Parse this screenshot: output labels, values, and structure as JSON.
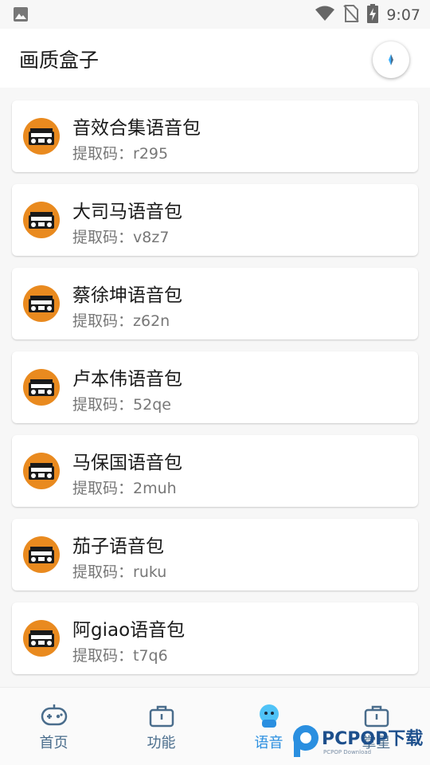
{
  "status_bar": {
    "time": "9:07",
    "icons": [
      "image-icon",
      "wifi-icon",
      "no-sim-icon",
      "battery-charging-icon"
    ]
  },
  "app_bar": {
    "title": "画质盒子",
    "action_icon": "compass-icon"
  },
  "voice_packs": [
    {
      "title": "音效合集语音包",
      "code_label": "提取码：",
      "code": "r295"
    },
    {
      "title": "大司马语音包",
      "code_label": "提取码：",
      "code": "v8z7"
    },
    {
      "title": "蔡徐坤语音包",
      "code_label": "提取码：",
      "code": "z62n"
    },
    {
      "title": "卢本伟语音包",
      "code_label": "提取码：",
      "code": "52qe"
    },
    {
      "title": "马保国语音包",
      "code_label": "提取码：",
      "code": "2muh"
    },
    {
      "title": "茄子语音包",
      "code_label": "提取码：",
      "code": "ruku"
    },
    {
      "title": "阿giao语音包",
      "code_label": "提取码：",
      "code": "t7q6"
    }
  ],
  "bottom_nav": {
    "items": [
      {
        "label": "首页",
        "icon": "gamepad-icon",
        "active": false
      },
      {
        "label": "功能",
        "icon": "toolbox-icon",
        "active": false
      },
      {
        "label": "语音",
        "icon": "robot-icon",
        "active": true
      },
      {
        "label": "掌星",
        "icon": "toolbox-icon",
        "active": false
      }
    ]
  },
  "watermark": {
    "brand": "PCPOP下载",
    "sub": "PCPOP Download"
  },
  "colors": {
    "accent": "#2a8fe0",
    "nav_inactive": "#4a6d8c",
    "radio_orange": "#e98a1f"
  }
}
